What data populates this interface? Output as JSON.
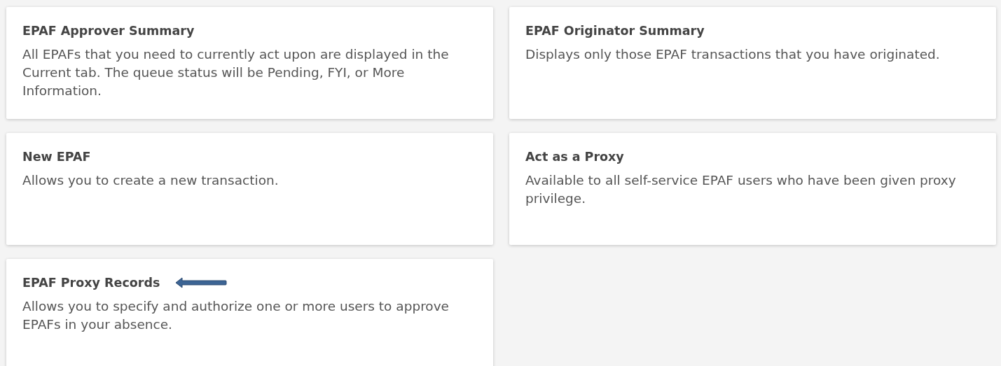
{
  "cards": [
    {
      "title": "EPAF Approver Summary",
      "description": "All EPAFs that you need to currently act upon are displayed in the Current tab. The queue status will be Pending, FYI, or More Information.",
      "arrow": false
    },
    {
      "title": "EPAF Originator Summary",
      "description": "Displays only those EPAF transactions that you have originated.",
      "arrow": false
    },
    {
      "title": "New EPAF",
      "description": "Allows you to create a new transaction.",
      "arrow": false
    },
    {
      "title": "Act as a Proxy",
      "description": "Available to all self-service EPAF users who have been given proxy privilege.",
      "arrow": false
    },
    {
      "title": "EPAF Proxy Records",
      "description": "Allows you to specify and authorize one or more users to approve EPAFs in your absence.",
      "arrow": true
    }
  ]
}
